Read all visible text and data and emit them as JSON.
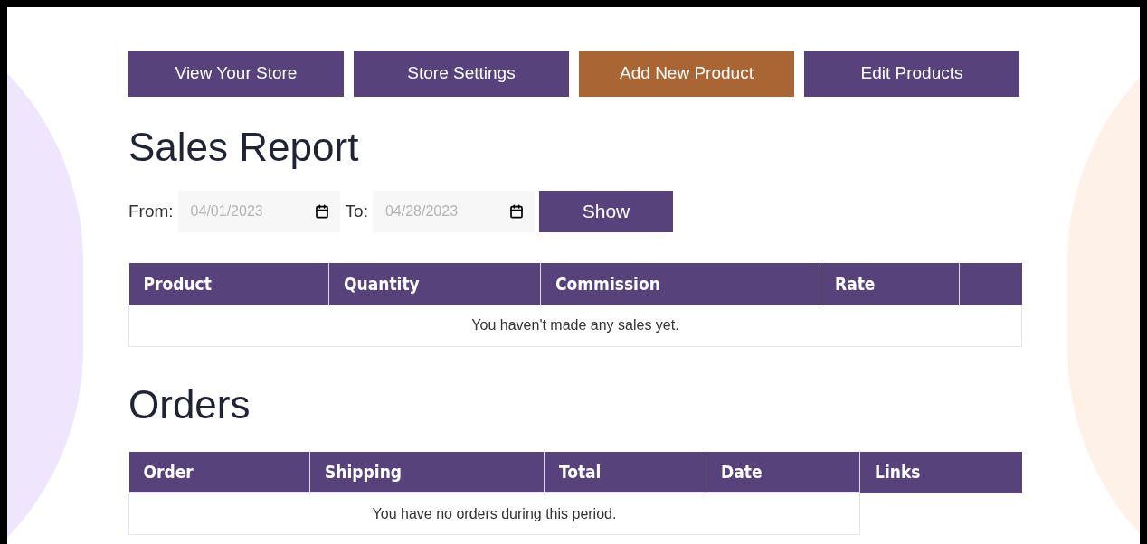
{
  "nav_buttons": [
    {
      "label": "View Your Store",
      "selected": false
    },
    {
      "label": "Store Settings",
      "selected": false
    },
    {
      "label": "Add New Product",
      "selected": true
    },
    {
      "label": "Edit Products",
      "selected": false
    }
  ],
  "sales_report": {
    "title": "Sales Report",
    "from_label": "From:",
    "from_value": "04/01/2023",
    "to_label": "To:",
    "to_value": "04/28/2023",
    "show_button": "Show",
    "table": {
      "columns": [
        "Product",
        "Quantity",
        "Commission",
        "Rate",
        ""
      ],
      "empty_message": "You haven't made any sales yet."
    }
  },
  "orders": {
    "title": "Orders",
    "table": {
      "columns": [
        "Order",
        "Shipping",
        "Total",
        "Date",
        "Links"
      ],
      "empty_message": "You have no orders during this period."
    }
  }
}
